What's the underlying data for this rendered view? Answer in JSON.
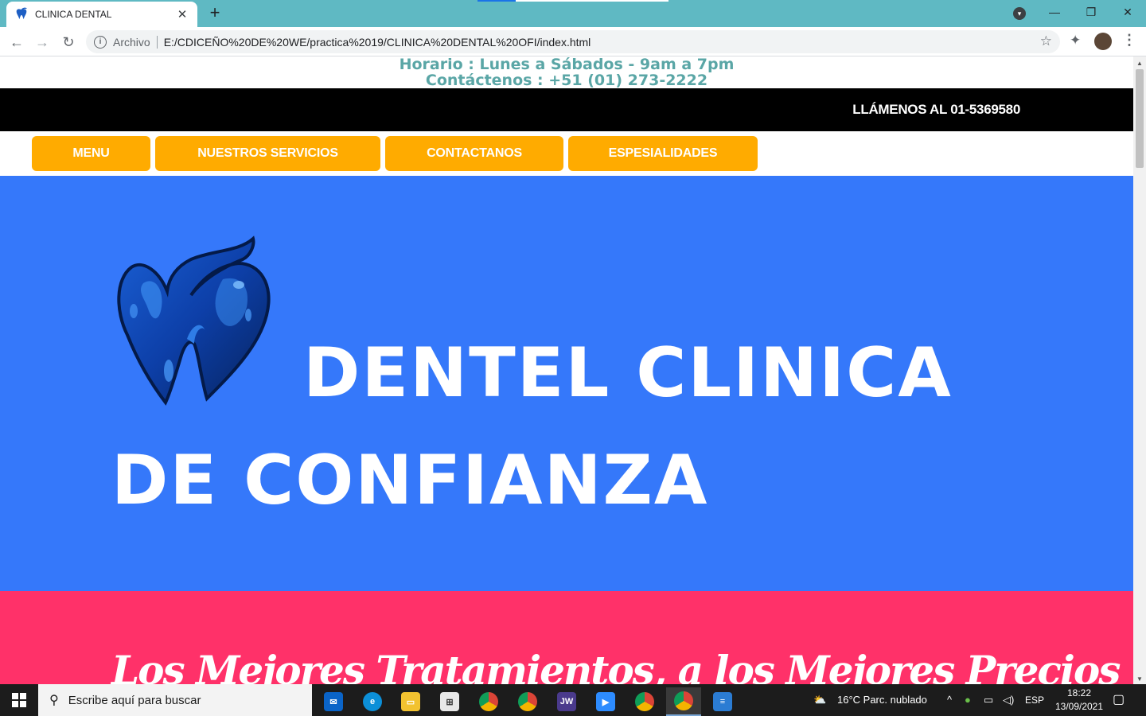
{
  "browser": {
    "tab_title": "CLINICA DENTAL",
    "tab_close": "✕",
    "new_tab": "+",
    "scheme_label": "Archivo",
    "url": "E:/CDICEÑO%20DE%20WE/practica%2019/CLINICA%20DENTAL%20OFI/index.html",
    "window_controls": {
      "minimize": "—",
      "restore": "❐",
      "close": "✕"
    }
  },
  "page": {
    "hours_line": "Horario : Lunes a Sábados - 9am a 7pm",
    "contact_line": "Contáctenos : +51 (01) 273-2222",
    "call_label": "LLÁMENOS AL 01-5369580",
    "menu": [
      {
        "label": "MENU"
      },
      {
        "label": "NUESTROS SERVICIOS"
      },
      {
        "label": "CONTACTANOS"
      },
      {
        "label": "ESPESIALIDADES"
      }
    ],
    "hero_line1": "DENTEL CLINICA",
    "hero_line2": "DE CONFIANZA",
    "promo_text": "Los Mejores Tratamientos, a los Mejores Precios",
    "colors": {
      "header_text": "#5aa6a6",
      "callbar": "#000000",
      "menu_button": "#ffab00",
      "hero_bg": "#3578fa",
      "promo_bg": "#ff3169",
      "tab_strip": "#5fb9c3"
    }
  },
  "taskbar": {
    "search_placeholder": "Escribe aquí para buscar",
    "apps": [
      "mail-icon",
      "edge-icon",
      "file-explorer-icon",
      "store-icon",
      "chrome-icon",
      "chrome-profile-icon",
      "jw-icon",
      "zoom-icon",
      "chrome-icon-2",
      "chrome-icon-3",
      "document-icon"
    ],
    "jw_label": "JW",
    "weather": "16°C  Parc. nublado",
    "language": "ESP",
    "time": "18:22",
    "date": "13/09/2021"
  }
}
